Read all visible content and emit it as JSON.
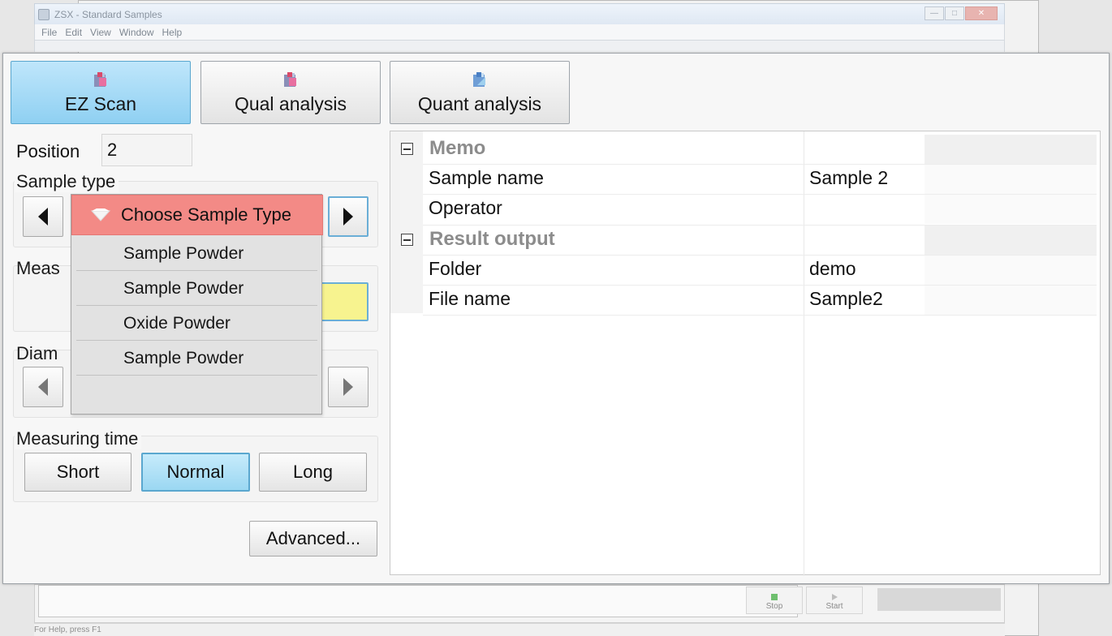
{
  "background_window": {
    "title": "ZSX - Standard Samples",
    "menu": [
      "File",
      "Edit",
      "View",
      "Window",
      "Help"
    ],
    "controls": [
      "minimize",
      "maximize",
      "close"
    ],
    "toolbar": {
      "stop_label": "Stop",
      "start_label": "Start"
    },
    "status_text": "For Help, press F1"
  },
  "mode_tabs": [
    {
      "label": "EZ Scan",
      "icon": "ez-scan-icon",
      "active": true
    },
    {
      "label": "Qual analysis",
      "icon": "qual-analysis-icon",
      "active": false
    },
    {
      "label": "Quant analysis",
      "icon": "quant-analysis-icon",
      "active": false
    }
  ],
  "position": {
    "label": "Position",
    "value": "2"
  },
  "sample_type": {
    "label": "Sample type",
    "dropdown": {
      "header": "Choose Sample Type",
      "items": [
        "Sample Powder",
        "Sample Powder",
        "Oxide Powder",
        "Sample Powder",
        ""
      ]
    }
  },
  "measure_group": {
    "label_visible": "Meas"
  },
  "diameter_group": {
    "label_visible": "Diam"
  },
  "measuring_time": {
    "label": "Measuring time",
    "options": [
      "Short",
      "Normal",
      "Long"
    ],
    "selected": "Normal"
  },
  "advanced_button": {
    "label": "Advanced..."
  },
  "properties": {
    "memo": {
      "category": "Memo",
      "rows": [
        {
          "name": "Sample name",
          "value": "Sample 2"
        },
        {
          "name": "Operator",
          "value": ""
        }
      ]
    },
    "result_output": {
      "category": "Result output",
      "rows": [
        {
          "name": "Folder",
          "value": "demo"
        },
        {
          "name": "File name",
          "value": "Sample2"
        }
      ]
    }
  },
  "colors": {
    "active_tab": "#8fd0f2",
    "dropdown_header": "#f38a86",
    "yellow_field": "#f7f38f",
    "focus_border": "#6aaed6"
  }
}
